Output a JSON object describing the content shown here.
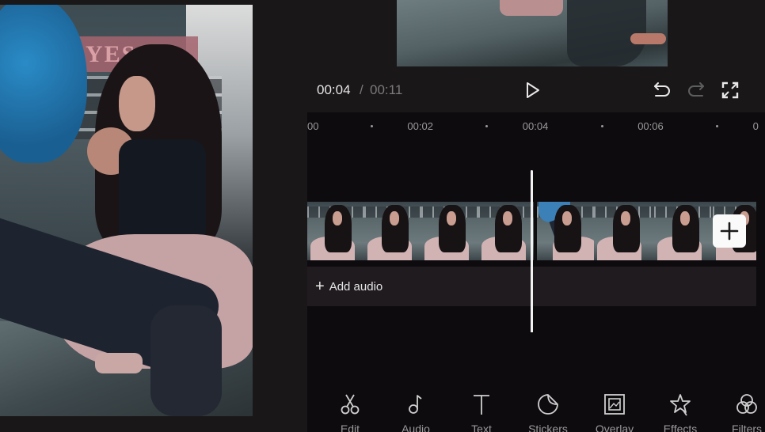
{
  "player": {
    "current_time": "00:04",
    "separator": "/",
    "total_time": "00:11",
    "play_icon": "play-icon",
    "undo_icon": "undo-icon",
    "redo_icon": "redo-icon",
    "fullscreen_icon": "fullscreen-icon"
  },
  "timeline": {
    "ruler": [
      {
        "label": "00",
        "kind": "label"
      },
      {
        "label": "",
        "kind": "dot"
      },
      {
        "label": "00:02",
        "kind": "label"
      },
      {
        "label": "",
        "kind": "dot"
      },
      {
        "label": "00:04",
        "kind": "label"
      },
      {
        "label": "",
        "kind": "dot"
      },
      {
        "label": "00:06",
        "kind": "label"
      },
      {
        "label": "",
        "kind": "dot"
      },
      {
        "label": "0",
        "kind": "label"
      }
    ],
    "clips": 2,
    "add_clip_icon": "plus-icon",
    "audio": {
      "add_audio_label": "Add audio",
      "plus_symbol": "+"
    }
  },
  "toolbar": {
    "items": [
      {
        "label": "Edit",
        "icon": "scissors-icon"
      },
      {
        "label": "Audio",
        "icon": "music-note-icon"
      },
      {
        "label": "Text",
        "icon": "text-icon"
      },
      {
        "label": "Stickers",
        "icon": "sticker-icon"
      },
      {
        "label": "Overlay",
        "icon": "overlay-icon"
      },
      {
        "label": "Effects",
        "icon": "effects-star-icon"
      },
      {
        "label": "Filters",
        "icon": "filters-icon"
      }
    ]
  },
  "preview": {
    "sign_text": "YES"
  },
  "colors": {
    "background": "#1a1719",
    "timeline_bg": "#0e0b0e",
    "audio_track_bg": "#1f1b1e",
    "playhead": "#f2f2f2",
    "text_primary": "#e6e6e6",
    "text_secondary": "#9a9a9a"
  }
}
